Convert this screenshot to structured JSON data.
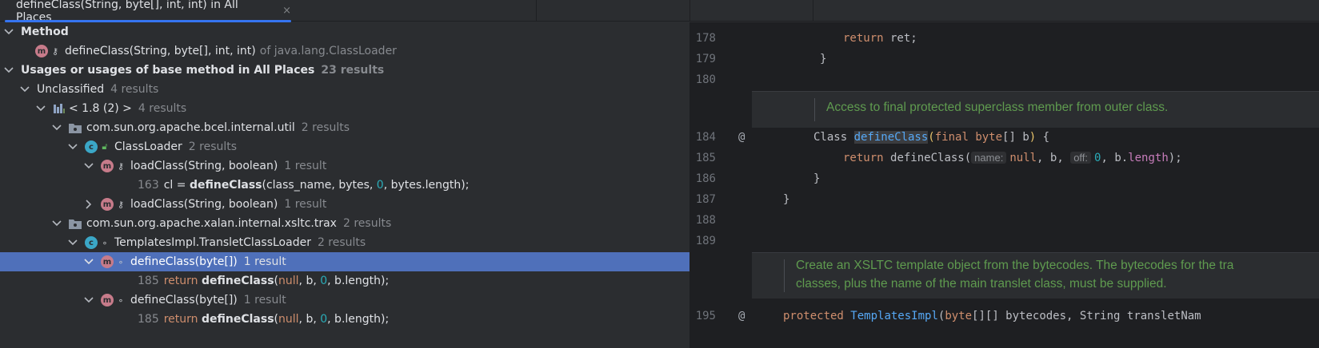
{
  "tab": {
    "title": "defineClass(String, byte[], int, int) in All Places",
    "close": "×"
  },
  "tree": {
    "method_header": "Method",
    "method_sig": "defineClass(String, byte[], int, int)",
    "method_of": "of java.lang.ClassLoader",
    "usages_header": "Usages or usages of base method in All Places",
    "usages_count": "23 results",
    "unclassified": "Unclassified",
    "unclassified_count": "4 results",
    "jdk": "< 1.8 (2) >",
    "jdk_count": "4 results",
    "pkg1": "com.sun.org.apache.bcel.internal.util",
    "pkg1_count": "2 results",
    "class1": "ClassLoader",
    "class1_count": "2 results",
    "m1": "loadClass(String, boolean)",
    "m1_count": "1 result",
    "m1_line": "163",
    "m1_code_pre": "cl = ",
    "m1_code_call": "defineClass",
    "m1_code_args_a": "(class_name, bytes, ",
    "m1_code_zero": "0",
    "m1_code_args_b": ", bytes.length);",
    "m2": "loadClass(String, boolean)",
    "m2_count": "1 result",
    "pkg2": "com.sun.org.apache.xalan.internal.xsltc.trax",
    "pkg2_count": "2 results",
    "class2": "TemplatesImpl.TransletClassLoader",
    "class2_count": "2 results",
    "m3": "defineClass(byte[])",
    "m3_count": "1 result",
    "m3_line": "185",
    "code_return": "return",
    "code_call": "defineClass",
    "code_null": "null",
    "code_b": ", b, ",
    "code_zero": "0",
    "code_len": ", b.length);",
    "m4": "defineClass(byte[])",
    "m4_count": "1 result",
    "m4_line": "185",
    "icon_m": "m",
    "icon_c": "c"
  },
  "editor": {
    "lines": {
      "l178": "178",
      "l179": "179",
      "l180": "180",
      "l184": "184",
      "l185": "185",
      "l186": "186",
      "l187": "187",
      "l188": "188",
      "l189": "189",
      "l195": "195"
    },
    "at": "@",
    "code178_kw": "return",
    "code178_rest": " ret;",
    "brace": "}",
    "doc1": "Access to final protected superclass member from outer class.",
    "c184_type": "Class ",
    "c184_fn": "defineClass",
    "c184_paren": "(",
    "c184_final": "final ",
    "c184_byte": "byte",
    "c184_arr": "[] b",
    "c184_close": ")",
    "c184_end": " {",
    "c185_kw": "return ",
    "c185_fn": "defineClass(",
    "hint_name": "name:",
    "c185_null": "null",
    "c185_b": ", b,",
    "hint_off": "off:",
    "c185_zero": "0",
    "c185_bdot": ", b.",
    "c185_len": "length",
    "c185_end": ");",
    "doc2_l1": "Create an XSLTC template object from the bytecodes. The bytecodes for the tra",
    "doc2_l2": "classes, plus the name of the main translet class, must be supplied.",
    "c195_kw": "protected ",
    "c195_fn": "TemplatesImpl",
    "c195_paren": "(",
    "c195_byte": "byte",
    "c195_rest": "[][] bytecodes, String transletNam"
  }
}
